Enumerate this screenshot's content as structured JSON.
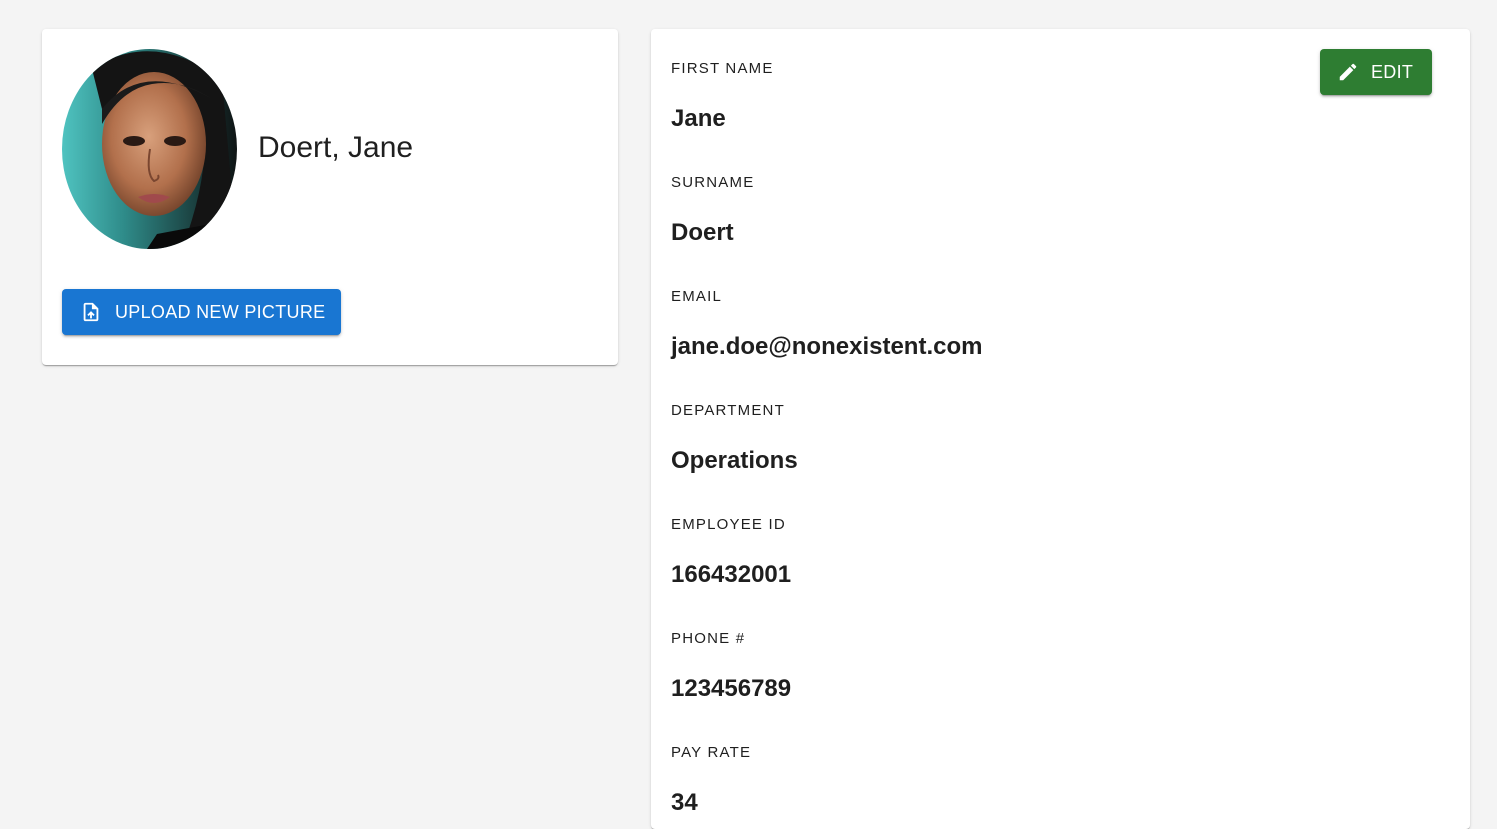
{
  "profile": {
    "display_name": "Doert, Jane",
    "upload_button_label": "UPLOAD NEW PICTURE",
    "avatar_alt": "Profile picture"
  },
  "details": {
    "edit_button_label": "EDIT",
    "fields": [
      {
        "label": "FIRST NAME",
        "value": "Jane"
      },
      {
        "label": "SURNAME",
        "value": "Doert"
      },
      {
        "label": "EMAIL",
        "value": "jane.doe@nonexistent.com"
      },
      {
        "label": "DEPARTMENT",
        "value": "Operations"
      },
      {
        "label": "EMPLOYEE ID",
        "value": "166432001"
      },
      {
        "label": "PHONE #",
        "value": "123456789"
      },
      {
        "label": "PAY RATE",
        "value": "34"
      }
    ]
  },
  "colors": {
    "page_background": "#f4f4f4",
    "upload_button": "#1976d2",
    "edit_button": "#2e7d32",
    "text": "#1f1f1f"
  },
  "icons": {
    "upload": "upload-file-icon",
    "edit": "pencil-icon"
  }
}
